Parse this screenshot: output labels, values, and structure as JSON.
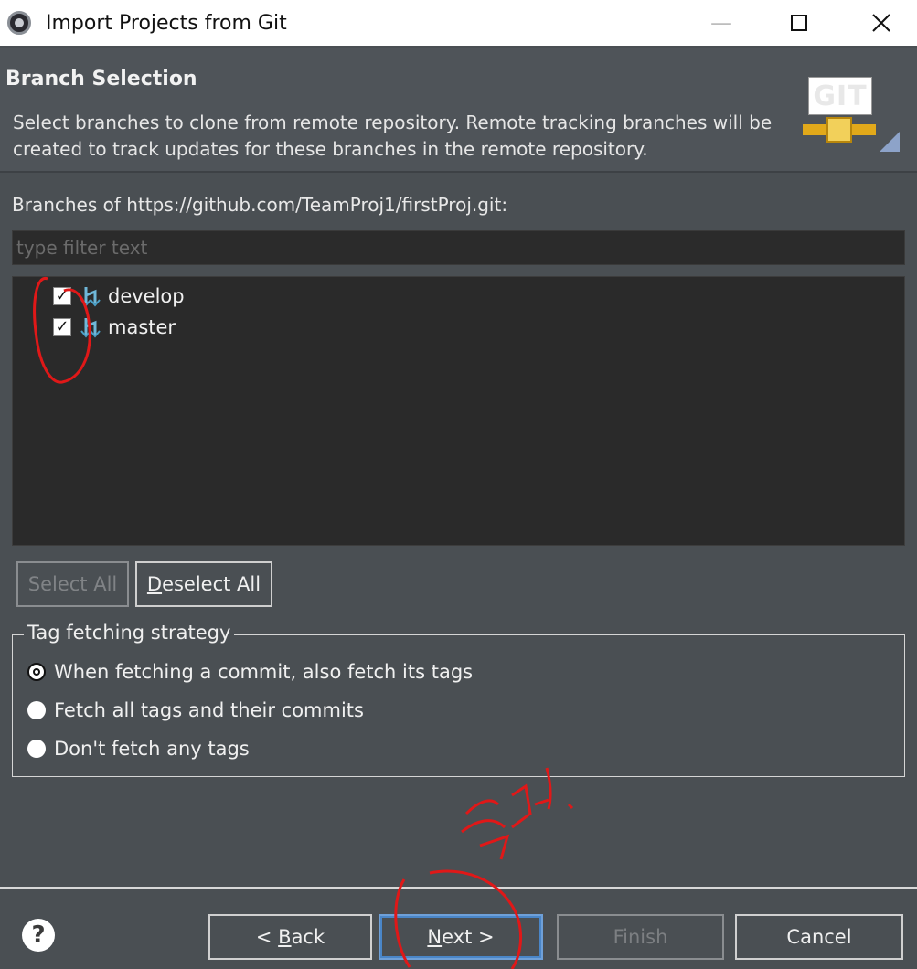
{
  "window": {
    "title": "Import Projects from Git"
  },
  "banner": {
    "title": "Branch Selection",
    "description": "Select branches to clone from remote repository. Remote tracking branches will be created to track updates for these branches in the remote repository.",
    "logo_text": "GIT"
  },
  "branches": {
    "label": "Branches of https://github.com/TeamProj1/firstProj.git:",
    "filter_placeholder": "type filter text",
    "filter_value": "",
    "items": [
      {
        "name": "develop",
        "checked": true
      },
      {
        "name": "master",
        "checked": true
      }
    ],
    "select_all_label": "Select All",
    "deselect_all_first_letter": "D",
    "deselect_all_rest": "eselect All"
  },
  "tag_fetching": {
    "legend": "Tag fetching strategy",
    "options": [
      {
        "label": "When fetching a commit, also fetch its tags",
        "selected": true
      },
      {
        "label": "Fetch all tags and their commits",
        "selected": false
      },
      {
        "label": "Don't fetch any tags",
        "selected": false
      }
    ]
  },
  "buttons": {
    "help_symbol": "?",
    "back_prefix": "< ",
    "back_letter": "B",
    "back_rest": "ack",
    "next_letter": "N",
    "next_rest": "ext >",
    "finish": "Finish",
    "cancel": "Cancel"
  },
  "colors": {
    "background": "#4a4f53",
    "list_background": "#2a2a2a",
    "annotation": "#e01818",
    "default_button_border": "#4a86c8"
  },
  "annotation": {
    "handwritten_text": "클릭!"
  }
}
